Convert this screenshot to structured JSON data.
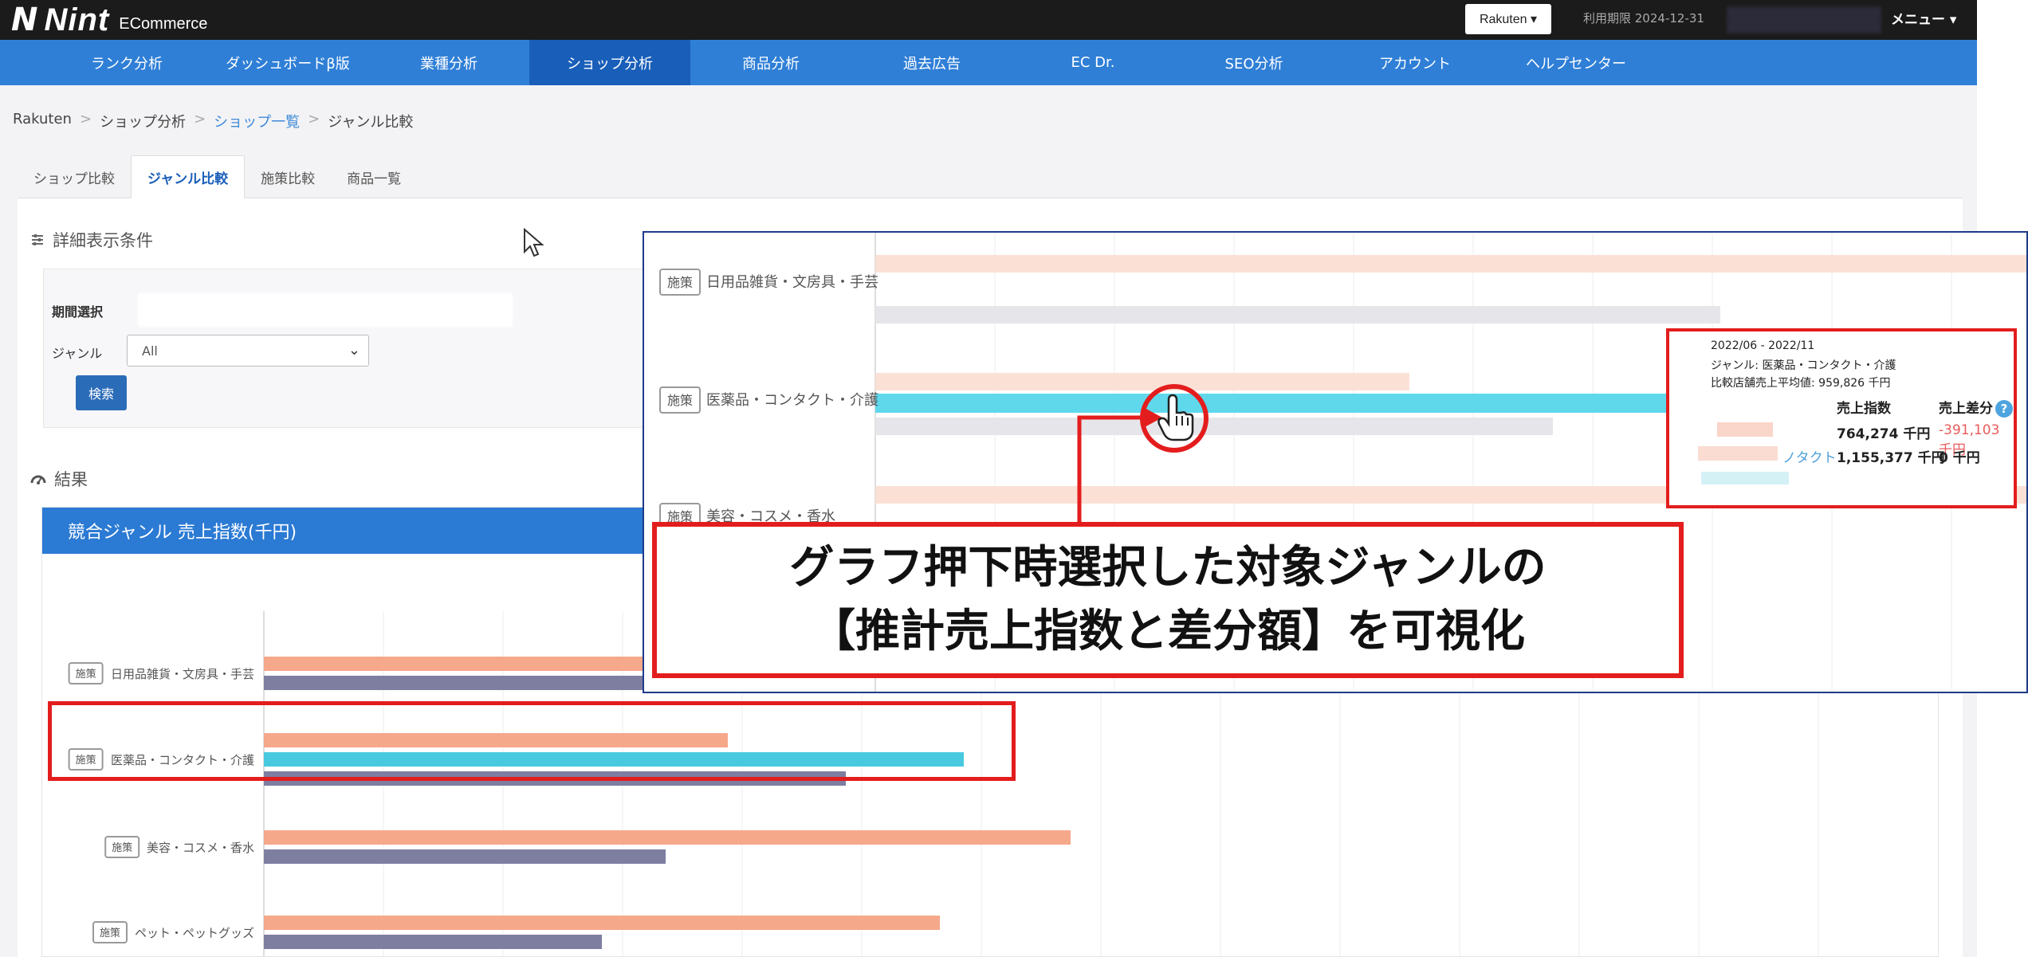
{
  "header": {
    "logo_mark": "N",
    "logo_text": "Nint",
    "logo_sub": "ECommerce",
    "platform": "Rakuten ▾",
    "expire": "利用期限 2024-12-31",
    "menu": "メニュー ▾"
  },
  "nav": {
    "items": [
      "ランク分析",
      "ダッシュボードβ版",
      "業種分析",
      "ショップ分析",
      "商品分析",
      "過去広告",
      "EC Dr.",
      "SEO分析",
      "アカウント",
      "ヘルプセンター"
    ],
    "active_index": 3
  },
  "breadcrumb": [
    "Rakuten",
    "ショップ分析",
    "ショップ一覧",
    "ジャンル比較"
  ],
  "tabs": [
    "ショップ比較",
    "ジャンル比較",
    "施策比較",
    "商品一覧"
  ],
  "active_tab": 1,
  "conditions": {
    "title": "詳細表示条件",
    "period_label": "期間選択",
    "genre_label": "ジャンル",
    "genre_value": "All",
    "search_label": "検索"
  },
  "results": {
    "title": "結果",
    "chart_title": "競合ジャンル 売上指数(千円)"
  },
  "chart": {
    "tag": "施策",
    "rows": [
      {
        "genre": "日用品雑貨・文房具・手芸"
      },
      {
        "genre": "医薬品・コンタクト・介護"
      },
      {
        "genre": "美容・コスメ・香水"
      },
      {
        "genre": "ペット・ペットグッズ"
      }
    ],
    "colors": {
      "orange": "#f6a88a",
      "cyan": "#48c9e0",
      "navy": "#7d7ea0"
    }
  },
  "zoom": {
    "rows": [
      "日用品雑貨・文房具・手芸",
      "医薬品・コンタクト・介護",
      "美容・コスメ・香水"
    ]
  },
  "tooltip": {
    "period": "2022/06 - 2022/11",
    "genre": "ジャンル: 医薬品・コンタクト・介護",
    "avg": "比較店舗売上平均値: 959,826 千円",
    "col_index": "売上指数",
    "col_diff": "売上差分",
    "help": "?",
    "row1_index": "764,274 千円",
    "row1_diff": "-391,103 千円",
    "row2_name": "ノタクト",
    "row2_index": "1,155,377 千円",
    "row2_diff": "0 千円"
  },
  "callout": {
    "line1": "グラフ押下時選択した対象ジャンルの",
    "line2": "【推計売上指数と差分額】を可視化"
  }
}
